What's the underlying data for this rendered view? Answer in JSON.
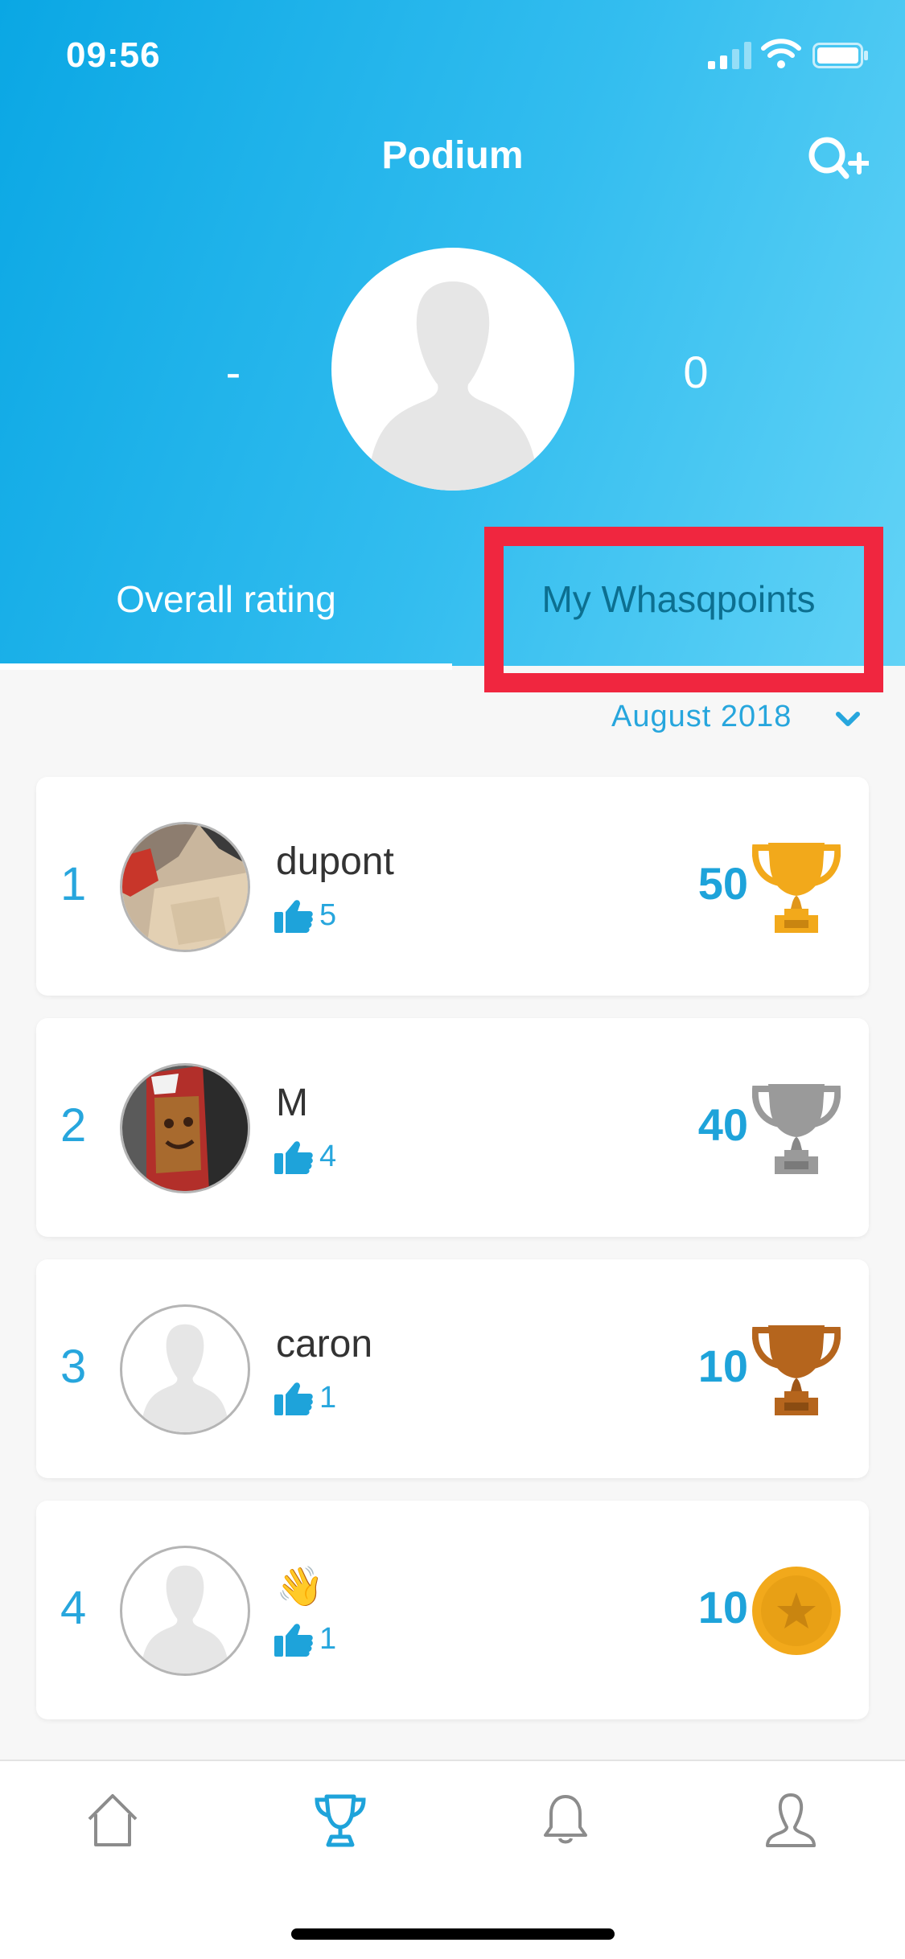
{
  "status_bar": {
    "time": "09:56"
  },
  "header": {
    "title": "Podium"
  },
  "profile": {
    "rank": "-",
    "points": "0"
  },
  "tabs": [
    {
      "label": "Overall rating",
      "active": true
    },
    {
      "label": "My Whasqpoints",
      "active": false,
      "highlighted": true
    }
  ],
  "filter": {
    "month": "August 2018"
  },
  "leaderboard": [
    {
      "rank": "1",
      "name": "dupont",
      "likes": "5",
      "score": "50",
      "medal": "gold-trophy",
      "avatar": "photo"
    },
    {
      "rank": "2",
      "name": "M",
      "likes": "4",
      "score": "40",
      "medal": "silver-trophy",
      "avatar": "photo"
    },
    {
      "rank": "3",
      "name": "caron",
      "likes": "1",
      "score": "10",
      "medal": "bronze-trophy",
      "avatar": "default"
    },
    {
      "rank": "4",
      "name": "👋",
      "likes": "1",
      "score": "10",
      "medal": "star-medal",
      "avatar": "default"
    }
  ],
  "tab_bar": {
    "items": [
      {
        "icon": "home-icon",
        "active": false
      },
      {
        "icon": "trophy-icon",
        "active": true
      },
      {
        "icon": "bell-icon",
        "active": false
      },
      {
        "icon": "profile-icon",
        "active": false
      }
    ]
  },
  "colors": {
    "accent": "#27a6dd",
    "highlight": "#f0263f",
    "gold": "#f2a91b",
    "silver": "#9a9a9a",
    "bronze": "#b5651d"
  }
}
